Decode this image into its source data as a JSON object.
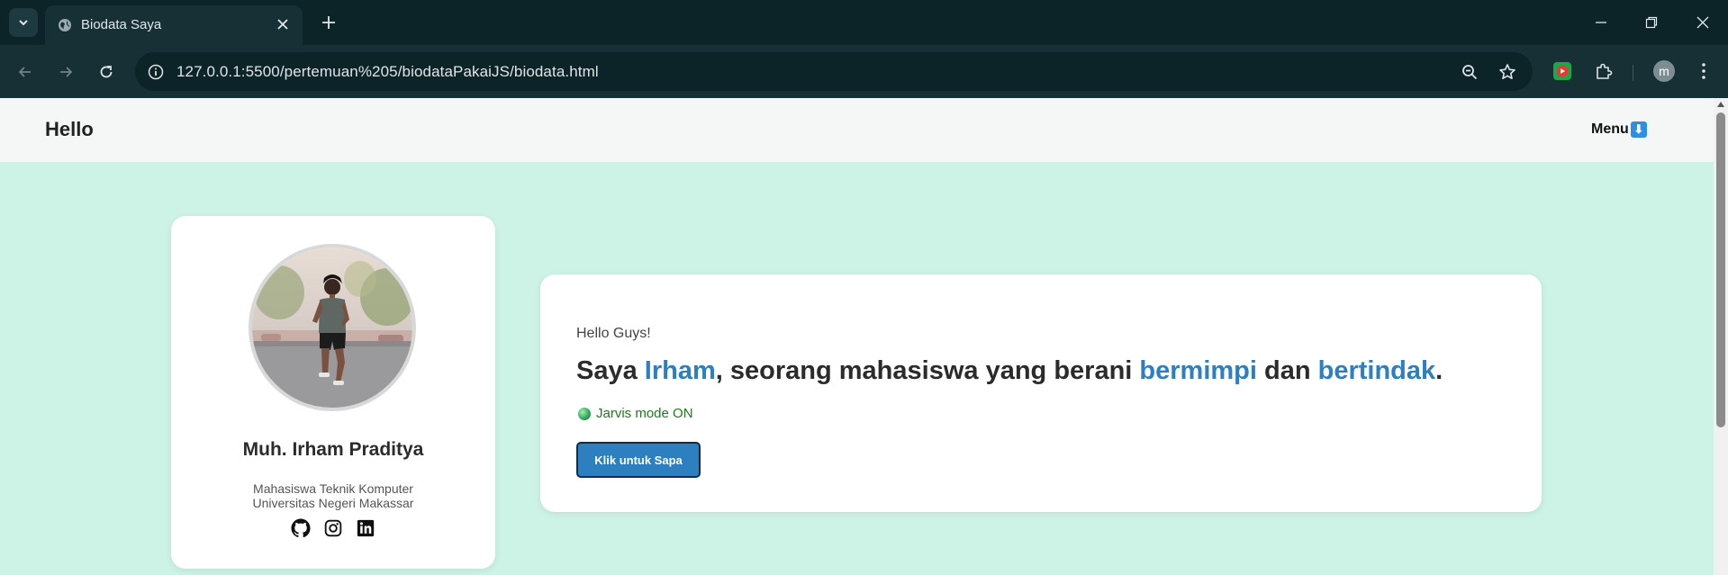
{
  "browser": {
    "tab_title": "Biodata Saya",
    "url": "127.0.0.1:5500/pertemuan%205/biodataPakaiJS/biodata.html",
    "profile_initial": "m"
  },
  "navbar": {
    "brand": "Hello",
    "menu_label": "Menu",
    "menu_emoji": "⬇"
  },
  "profile": {
    "name": "Muh. Irham Praditya",
    "role": "Mahasiswa Teknik Komputer",
    "university": "Universitas Negeri Makassar",
    "socials": [
      "github-icon",
      "instagram-icon",
      "linkedin-icon"
    ]
  },
  "intro": {
    "greeting": "Hello Guys!",
    "headline": {
      "part1": "Saya ",
      "name": "Irham",
      "part2": ", seorang mahasiswa yang berani ",
      "word1": "bermimpi",
      "part3": " dan ",
      "word2": "bertindak",
      "part4": "."
    },
    "status": "Jarvis mode ON",
    "button_label": "Klik untuk Sapa"
  },
  "colors": {
    "page_bg": "#cdf2e6",
    "accent": "#2d7fbf",
    "status_text": "#1d7a1d"
  }
}
